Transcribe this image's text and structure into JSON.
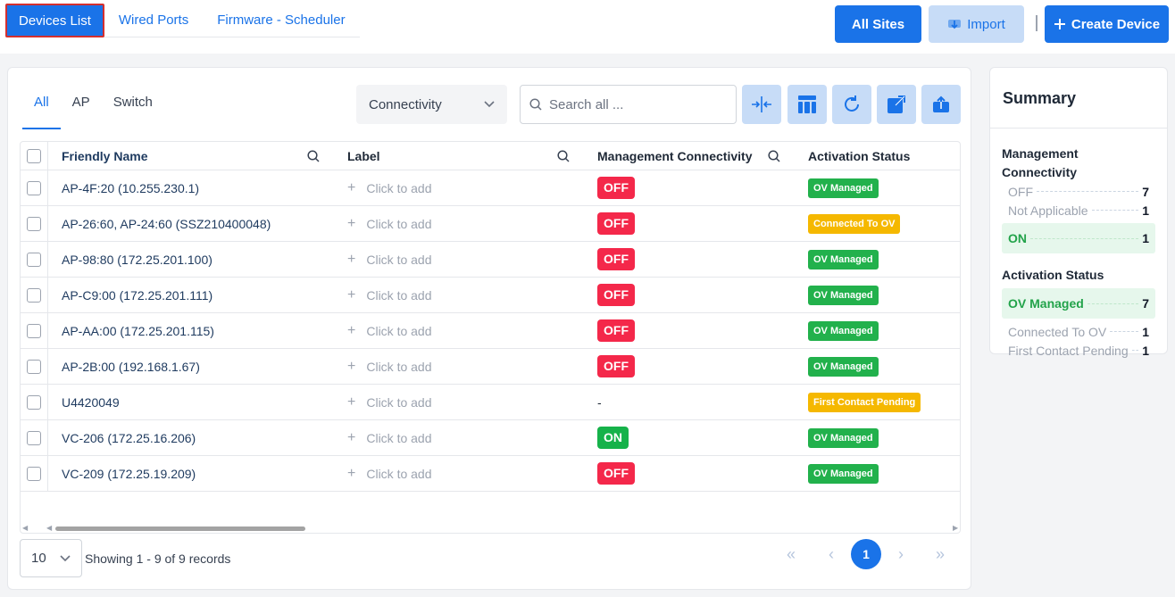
{
  "top_tabs": [
    {
      "label": "Devices List",
      "active": true
    },
    {
      "label": "Wired Ports",
      "active": false
    },
    {
      "label": "Firmware - Scheduler",
      "active": false
    }
  ],
  "header_buttons": {
    "all_sites": "All Sites",
    "import": "Import",
    "create_device": "Create Device"
  },
  "sub_tabs": [
    {
      "label": "All",
      "active": true
    },
    {
      "label": "AP",
      "active": false
    },
    {
      "label": "Switch",
      "active": false
    }
  ],
  "filter": {
    "connectivity_label": "Connectivity"
  },
  "search": {
    "placeholder": "Search all ..."
  },
  "toolbar_icons": [
    "collapse-columns-icon",
    "column-layout-icon",
    "refresh-icon",
    "open-external-icon",
    "upload-icon"
  ],
  "table": {
    "columns": {
      "name": "Friendly Name",
      "label": "Label",
      "connectivity": "Management Connectivity",
      "activation": "Activation Status"
    },
    "add_label_text": "Click to add",
    "rows": [
      {
        "name": "AP-4F:20 (10.255.230.1)",
        "connectivity": "OFF",
        "activation": "OV Managed"
      },
      {
        "name": "AP-26:60, AP-24:60 (SSZ210400048)",
        "connectivity": "OFF",
        "activation": "Connected To OV"
      },
      {
        "name": "AP-98:80 (172.25.201.100)",
        "connectivity": "OFF",
        "activation": "OV Managed"
      },
      {
        "name": "AP-C9:00 (172.25.201.111)",
        "connectivity": "OFF",
        "activation": "OV Managed"
      },
      {
        "name": "AP-AA:00 (172.25.201.115)",
        "connectivity": "OFF",
        "activation": "OV Managed"
      },
      {
        "name": "AP-2B:00 (192.168.1.67)",
        "connectivity": "OFF",
        "activation": "OV Managed"
      },
      {
        "name": "U4420049",
        "connectivity": "-",
        "activation": "First Contact Pending"
      },
      {
        "name": "VC-206 (172.25.16.206)",
        "connectivity": "ON",
        "activation": "OV Managed"
      },
      {
        "name": "VC-209 (172.25.19.209)",
        "connectivity": "OFF",
        "activation": "OV Managed"
      }
    ]
  },
  "pagination": {
    "page_size": "10",
    "records_text": "Showing 1 - 9 of 9 records",
    "current_page": "1"
  },
  "summary": {
    "title": "Summary",
    "management_title": "Management Connectivity",
    "management": [
      {
        "label": "OFF",
        "count": "7",
        "highlight": false
      },
      {
        "label": "Not Applicable",
        "count": "1",
        "highlight": false
      },
      {
        "label": "ON",
        "count": "1",
        "highlight": true
      }
    ],
    "activation_title": "Activation Status",
    "activation": [
      {
        "label": "OV Managed",
        "count": "7",
        "highlight": true
      },
      {
        "label": "Connected To OV",
        "count": "1",
        "highlight": false
      },
      {
        "label": "First Contact Pending",
        "count": "1",
        "highlight": false
      }
    ]
  },
  "colors": {
    "primary": "#1a73e8",
    "off_red": "#f4284a",
    "on_green": "#16b24a",
    "ov_managed_green": "#22b14c",
    "pending_yellow": "#f5b800"
  }
}
